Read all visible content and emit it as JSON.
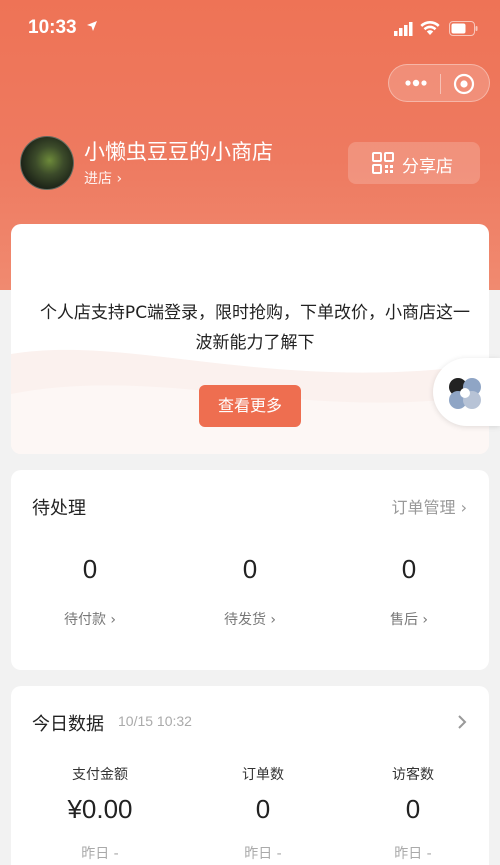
{
  "status_bar": {
    "time": "10:33"
  },
  "shop": {
    "name": "小懒虫豆豆的小商店",
    "enter_label": "进店 ›",
    "share_label": "分享店"
  },
  "promo": {
    "text": "个人店支持PC端登录，限时抢购，下单改价，小商店这一波新能力了解下",
    "button_label": "查看更多"
  },
  "pending": {
    "title": "待处理",
    "order_management_label": "订单管理 ›",
    "items": [
      {
        "value": "0",
        "label": "待付款 ›"
      },
      {
        "value": "0",
        "label": "待发货 ›"
      },
      {
        "value": "0",
        "label": "售后 ›"
      }
    ]
  },
  "today": {
    "title": "今日数据",
    "timestamp": "10/15 10:32",
    "items": [
      {
        "label": "支付金额",
        "value": "¥0.00",
        "yesterday": "昨日 -"
      },
      {
        "label": "订单数",
        "value": "0",
        "yesterday": "昨日 -"
      },
      {
        "label": "访客数",
        "value": "0",
        "yesterday": "昨日 -"
      }
    ]
  },
  "colors": {
    "brand": "#ee7356",
    "button": "#ee6e50"
  }
}
